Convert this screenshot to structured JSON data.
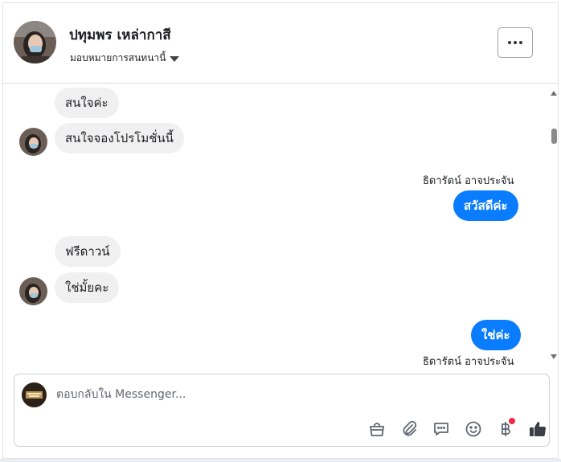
{
  "header": {
    "contact_name": "ปทุมพร เหล่ากาสี",
    "assign_label": "มอบหมายการสนทนานี้",
    "more_label": "..."
  },
  "messages": [
    {
      "direction": "in",
      "text": "สนใจค่ะ"
    },
    {
      "direction": "in",
      "text": "สนใจจองโปรโมชั่นนี้"
    },
    {
      "direction": "out",
      "sender": "ธิดารัตน์ อาจประจัน",
      "text": "สวัสดีค่ะ"
    },
    {
      "direction": "in",
      "text": "ฟรีดาวน์"
    },
    {
      "direction": "in",
      "text": "ใช่มั้ยคะ"
    },
    {
      "direction": "out",
      "sender": "ธิดารัตน์ อาจประจัน",
      "text": "ใช่ค่ะ"
    }
  ],
  "composer": {
    "placeholder": "ตอบกลับใน Messenger..."
  },
  "toolbar": {
    "icons": [
      "shopping-bag-icon",
      "paperclip-icon",
      "saved-reply-icon",
      "emoji-icon",
      "baht-icon",
      "thumbs-up-icon"
    ],
    "notification_dot_color": "#f02849",
    "accent_color": "#0a7cff"
  }
}
